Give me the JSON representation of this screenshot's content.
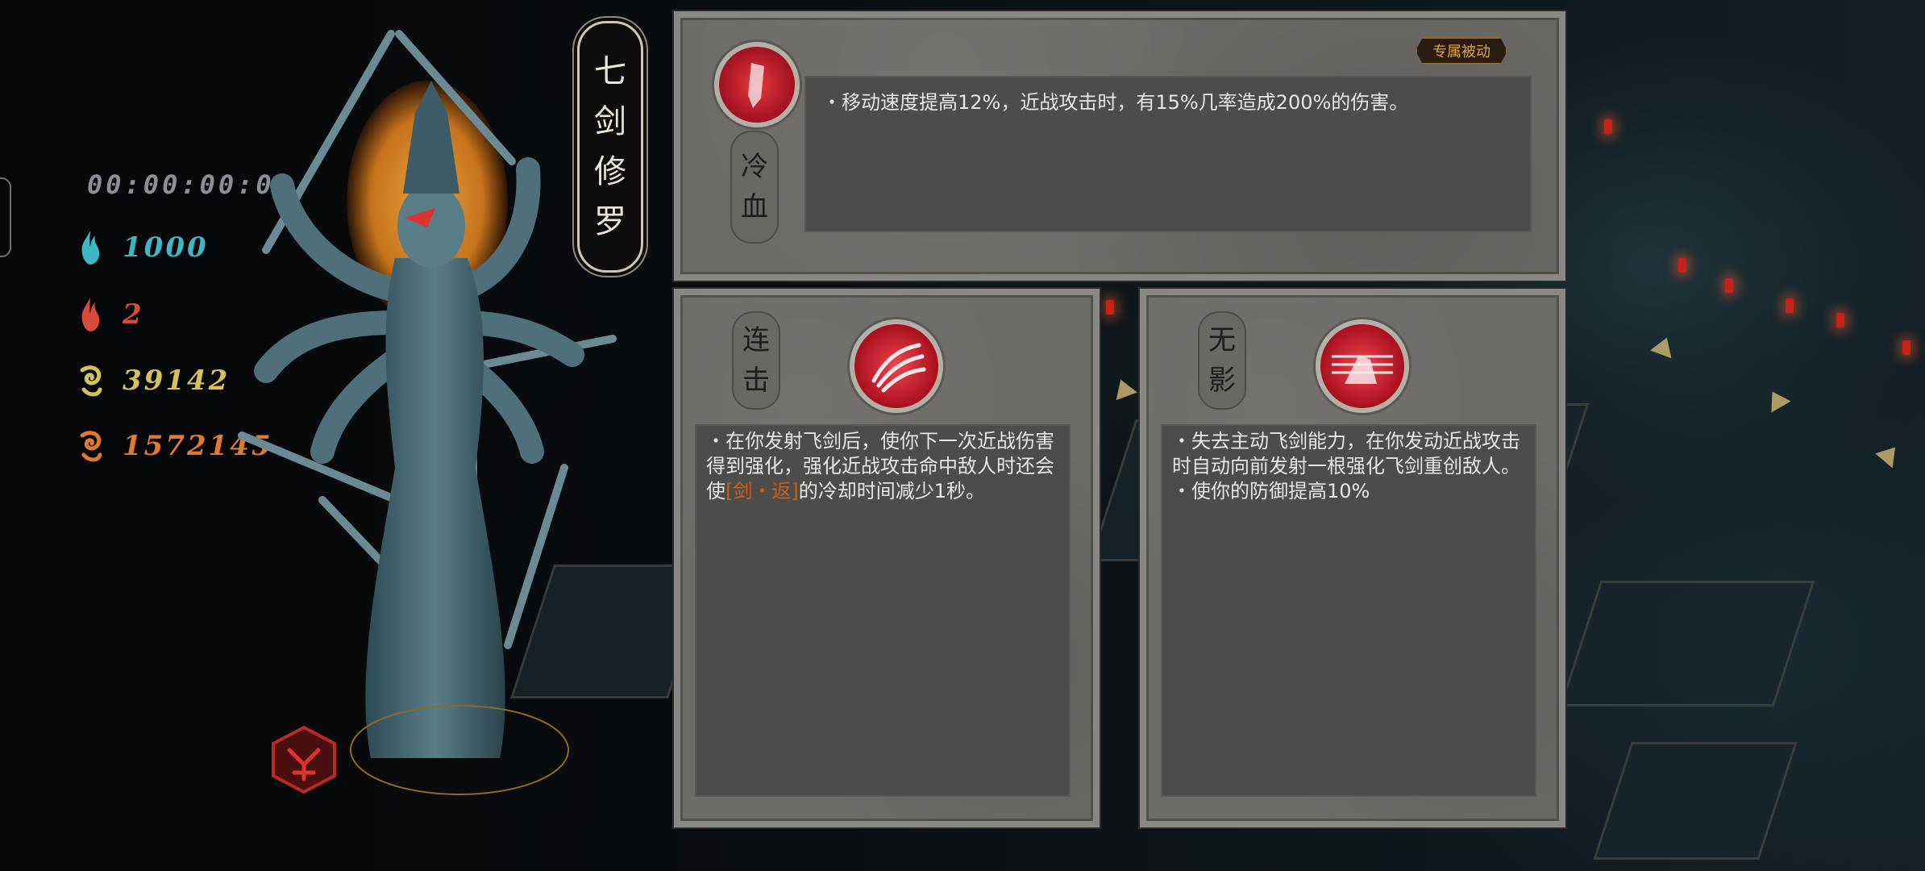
{
  "timer": "00:00:00:00",
  "stats": [
    {
      "icon": "cyan-flame-icon",
      "value": "1000",
      "color": "#3fb6c4"
    },
    {
      "icon": "red-flame-icon",
      "value": "2",
      "color": "#d84a3a"
    },
    {
      "icon": "yellow-spiral-icon",
      "value": "39142",
      "color": "#d6c25a"
    },
    {
      "icon": "orange-spiral-icon",
      "value": "1572145",
      "color": "#e07a2e"
    }
  ],
  "title_chars": [
    "七",
    "剑",
    "修",
    "罗"
  ],
  "main_skill": {
    "tag": "专属被动",
    "name_chars": [
      "冷",
      "血"
    ],
    "desc": "・移动速度提高12%，近战攻击时，有15%几率造成200%的伤害。"
  },
  "skill_left": {
    "name_chars": [
      "连",
      "击"
    ],
    "desc_before": "・在你发射飞剑后，使你下一次近战伤害得到强化，强化近战攻击命中敌人时还会使",
    "desc_highlight": "[剑・返]",
    "desc_after": "的冷却时间减少1秒。"
  },
  "skill_right": {
    "name_chars": [
      "无",
      "影"
    ],
    "desc_lines": [
      "・失去主动飞剑能力，在你发动近战攻击时自动向前发射一根强化飞剑重创敌人。",
      "・使你的防御提高10%"
    ]
  },
  "colors": {
    "panel": "#6d6b68",
    "desc_bg": "#4d4c4a",
    "highlight": "#c8611a",
    "gold": "#d8a347"
  }
}
